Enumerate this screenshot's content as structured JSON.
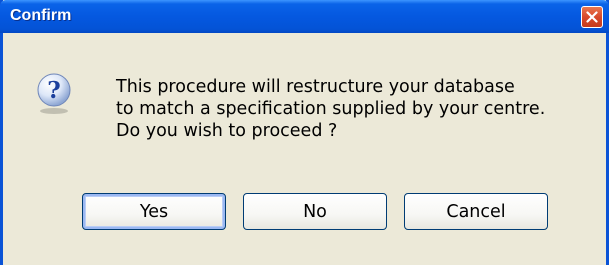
{
  "dialog": {
    "title": "Confirm",
    "icon": "question-icon",
    "message_lines": [
      "This procedure will restructure your database",
      "to match a specification supplied by your centre.",
      "Do you wish to proceed ?"
    ],
    "buttons": {
      "yes": "Yes",
      "no": "No",
      "cancel": "Cancel"
    },
    "close_icon": "close-icon"
  },
  "colors": {
    "titlebar": "#0558e0",
    "close_button": "#d8492b",
    "dialog_face": "#ece9d8"
  }
}
